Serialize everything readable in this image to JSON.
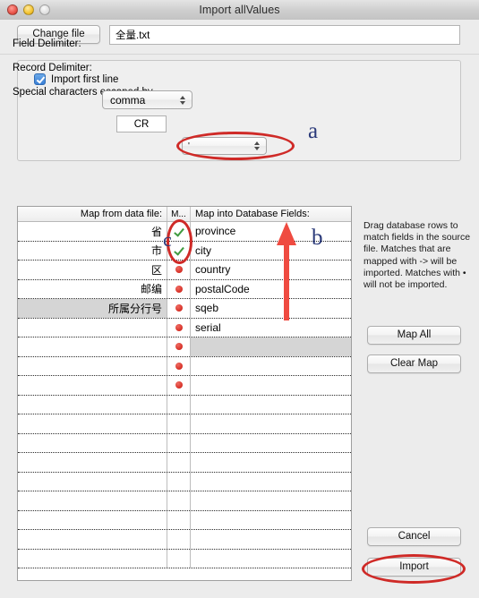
{
  "window": {
    "title": "Import allValues",
    "traffic_lights": [
      "close-light",
      "minimize-light",
      "zoom-light"
    ]
  },
  "file_row": {
    "change_file_label": "Change file",
    "file_name": "全量.txt"
  },
  "options": {
    "import_first_line_label": "Import first line",
    "import_first_line_checked": true,
    "field_delimiter_label": "Field Delimiter:",
    "field_delimiter_value": "comma",
    "record_delimiter_label": "Record Delimiter:",
    "record_delimiter_value": "CR",
    "escape_label": "Special characters escaped by",
    "escape_value": "'"
  },
  "table": {
    "headers": {
      "source": "Map from data file:",
      "map": "M...",
      "dest": "Map into Database Fields:"
    },
    "rows": [
      {
        "source": "省",
        "map": "check",
        "dest": "province",
        "src_alt": false,
        "dest_alt": false
      },
      {
        "source": "市",
        "map": "check",
        "dest": "city",
        "src_alt": false,
        "dest_alt": false
      },
      {
        "source": "区",
        "map": "dot",
        "dest": "country",
        "src_alt": false,
        "dest_alt": false
      },
      {
        "source": "邮编",
        "map": "dot",
        "dest": "postalCode",
        "src_alt": false,
        "dest_alt": false
      },
      {
        "source": "所属分行号",
        "map": "dot",
        "dest": "sqeb",
        "src_alt": true,
        "dest_alt": false
      },
      {
        "source": "",
        "map": "dot",
        "dest": "serial",
        "src_alt": false,
        "dest_alt": false
      },
      {
        "source": "",
        "map": "dot",
        "dest": "",
        "src_alt": false,
        "dest_alt": true
      },
      {
        "source": "",
        "map": "dot",
        "dest": "",
        "src_alt": false,
        "dest_alt": false
      },
      {
        "source": "",
        "map": "dot",
        "dest": "",
        "src_alt": false,
        "dest_alt": false
      },
      {
        "source": "",
        "map": "",
        "dest": "",
        "src_alt": false,
        "dest_alt": false
      },
      {
        "source": "",
        "map": "",
        "dest": "",
        "src_alt": false,
        "dest_alt": false
      },
      {
        "source": "",
        "map": "",
        "dest": "",
        "src_alt": false,
        "dest_alt": false
      },
      {
        "source": "",
        "map": "",
        "dest": "",
        "src_alt": false,
        "dest_alt": false
      },
      {
        "source": "",
        "map": "",
        "dest": "",
        "src_alt": false,
        "dest_alt": false
      },
      {
        "source": "",
        "map": "",
        "dest": "",
        "src_alt": false,
        "dest_alt": false
      },
      {
        "source": "",
        "map": "",
        "dest": "",
        "src_alt": false,
        "dest_alt": false
      },
      {
        "source": "",
        "map": "",
        "dest": "",
        "src_alt": false,
        "dest_alt": false
      },
      {
        "source": "",
        "map": "",
        "dest": "",
        "src_alt": false,
        "dest_alt": false
      }
    ]
  },
  "side_panel": {
    "help_text": "Drag database rows to match fields in the source file.  Matches that are mapped with -> will be imported. Matches with • will not be imported.",
    "map_all_label": "Map All",
    "clear_map_label": "Clear Map",
    "cancel_label": "Cancel",
    "import_label": "Import"
  },
  "annotations": {
    "color_letter": "#2b3a7a",
    "color_mark": "#cf2a27",
    "letters": [
      {
        "id": "a",
        "text": "a"
      },
      {
        "id": "b",
        "text": "b"
      },
      {
        "id": "c",
        "text": "c"
      }
    ],
    "arrow": {
      "direction": "up",
      "color": "#ef4b41"
    },
    "ellipses": [
      "escape-dropdown",
      "map-checkmarks",
      "import-button"
    ]
  }
}
